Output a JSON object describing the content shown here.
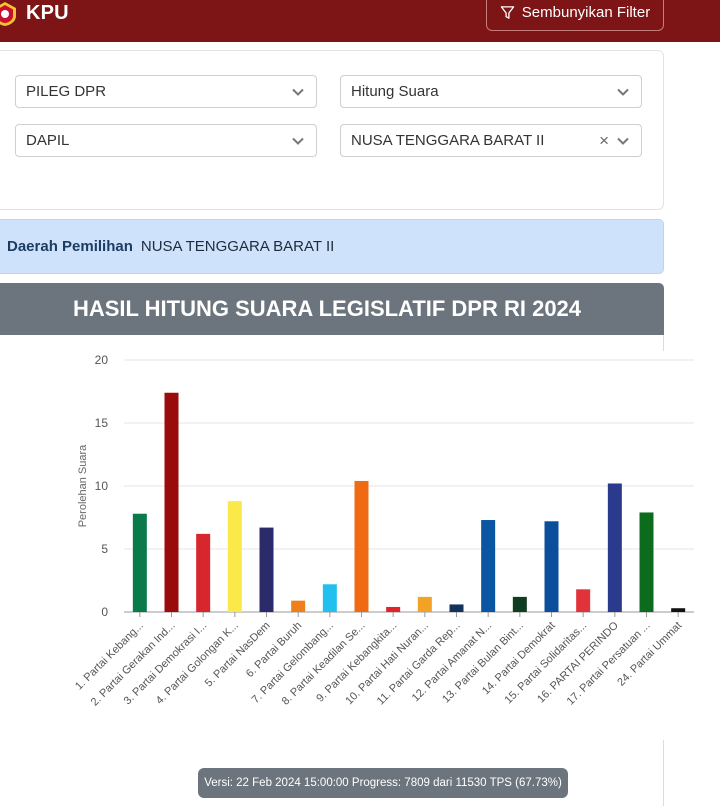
{
  "header": {
    "brand": "KPU",
    "filter_button_label": "Sembunyikan Filter"
  },
  "filters": {
    "election": "PILEG DPR",
    "mode": "Hitung Suara",
    "level": "DAPIL",
    "region": "NUSA TENGGARA BARAT II",
    "clear_glyph": "×"
  },
  "info": {
    "label": "Daerah Pemilihan",
    "value": "NUSA TENGGARA BARAT II"
  },
  "chart_title": "HASIL HITUNG SUARA LEGISLATIF DPR RI 2024",
  "chart_data": {
    "type": "bar",
    "ylabel": "Perolehan Suara",
    "ylim": [
      0,
      20
    ],
    "yticks": [
      0,
      5,
      10,
      15,
      20
    ],
    "grid": true,
    "categories": [
      "1. Partai Kebang...",
      "2. Partai Gerakan Ind...",
      "3. Partai Demokrasi I...",
      "4. Partai Golongan K...",
      "5. Partai NasDem",
      "6. Partai Buruh",
      "7. Partai Gelombang...",
      "8. Partai Keadilan Se...",
      "9. Partai Kebangkita...",
      "10. Partai Hati Nuran...",
      "11. Partai Garda Rep...",
      "12. Partai Amanat N...",
      "13. Partai Bulan Bint...",
      "14. Partai Demokrat",
      "15. Partai Solidaritas...",
      "16. PARTAI PERINDO",
      "17. Partai Persatuan ...",
      "24. Partai Ummat"
    ],
    "values": [
      7.8,
      17.4,
      6.2,
      8.8,
      6.7,
      0.9,
      2.2,
      10.4,
      0.4,
      1.2,
      0.6,
      7.3,
      1.2,
      7.2,
      1.8,
      10.2,
      7.9,
      0.3
    ],
    "colors": [
      "#0b7a4b",
      "#9a0c0c",
      "#d8262d",
      "#fbe94a",
      "#2b2a6b",
      "#ef7f1a",
      "#22c0ee",
      "#f06a14",
      "#e3232a",
      "#f2a224",
      "#14325c",
      "#0b56a3",
      "#0e3d22",
      "#0b4e9c",
      "#e2333a",
      "#2a3a8c",
      "#0d6b1e",
      "#111111"
    ]
  },
  "footer": {
    "version_text": "Versi: 22 Feb 2024 15:00:00 Progress: 7809 dari 11530 TPS (67.73%)"
  }
}
